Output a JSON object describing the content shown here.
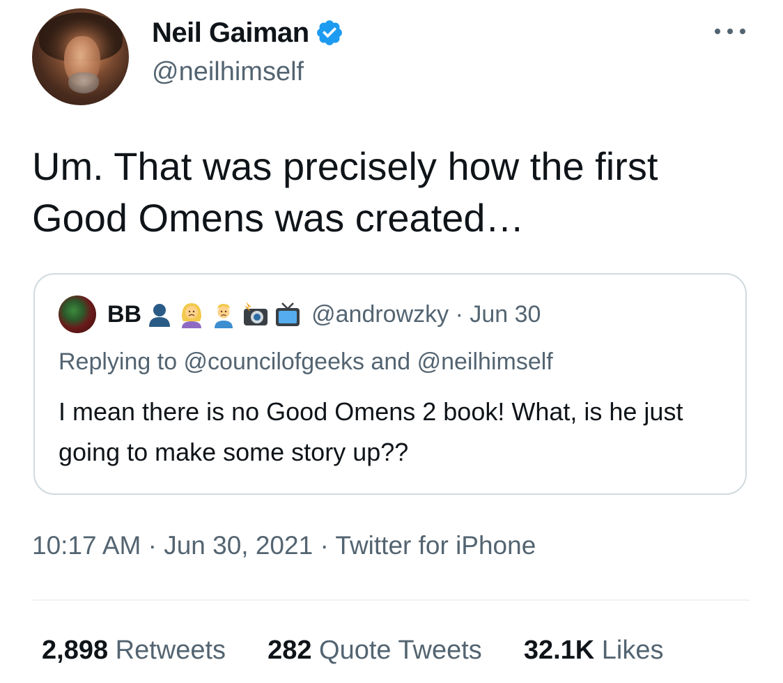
{
  "author": {
    "display_name": "Neil Gaiman",
    "handle": "@neilhimself",
    "verified": true,
    "verified_color": "#1d9bf0"
  },
  "tweet": {
    "text": "Um. That was precisely how the first Good Omens was created…"
  },
  "quote": {
    "name": "BB",
    "name_emojis": [
      "bust-silhouette-icon",
      "woman-frowning-icon",
      "man-frowning-icon",
      "camera-flash-icon",
      "television-icon"
    ],
    "handle": "@androwzky · Jun 30",
    "reply_line": "Replying to @councilofgeeks and @neilhimself",
    "text": "I mean there is no Good Omens 2 book!  What, is he just going to make some story up??"
  },
  "meta": {
    "timestamp": "10:17 AM · Jun 30, 2021 · Twitter for iPhone"
  },
  "stats": {
    "retweets_count": "2,898",
    "retweets_label": "Retweets",
    "quotes_count": "282",
    "quotes_label": "Quote Tweets",
    "likes_count": "32.1K",
    "likes_label": "Likes"
  },
  "colors": {
    "text_primary": "#0f1419",
    "text_secondary": "#536471",
    "border": "#cfd9de"
  }
}
